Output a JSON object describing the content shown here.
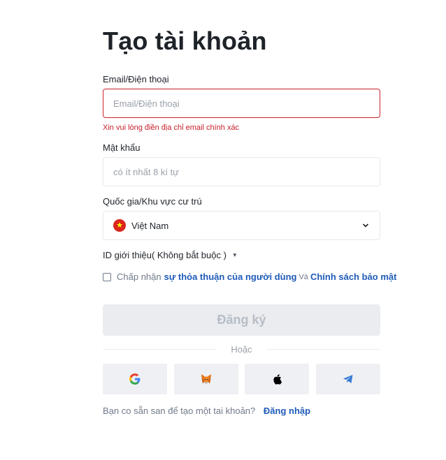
{
  "title": "Tạo tài khoản",
  "email": {
    "label": "Email/Điện thoại",
    "placeholder": "Email/Điện thoại",
    "value": "",
    "error": "Xin vui lòng điền địa chỉ email chính xác",
    "error_color": "#c9202b"
  },
  "password": {
    "label": "Mật khẩu",
    "placeholder": "có ít nhất 8 kí tự",
    "value": ""
  },
  "country": {
    "label": "Quốc gia/Khu vực cư trú",
    "selected": "Việt Nam",
    "flag_icon": "vietnam-flag-icon",
    "dropdown_icon": "chevron-down-icon"
  },
  "referral": {
    "label": "ID giới thiệu( Không bắt buộc )",
    "expand_icon": "caret-down-icon"
  },
  "terms": {
    "checked": false,
    "prefix": "Chấp nhận",
    "user_agreement": "sự thỏa thuận của người dùng",
    "conjunction": "Và",
    "privacy_policy": "Chính sách bảo mật",
    "link_color": "#1e5bb8"
  },
  "submit_label": "Đăng ký",
  "divider_text": "Hoặc",
  "social_logins": [
    {
      "name": "google",
      "icon": "google-icon"
    },
    {
      "name": "metamask",
      "icon": "metamask-icon"
    },
    {
      "name": "apple",
      "icon": "apple-icon"
    },
    {
      "name": "telegram",
      "icon": "telegram-icon"
    }
  ],
  "footer": {
    "text": "Bạn co sẵn san để tạo một tai khoản?",
    "login_link": "Đăng nhập"
  }
}
